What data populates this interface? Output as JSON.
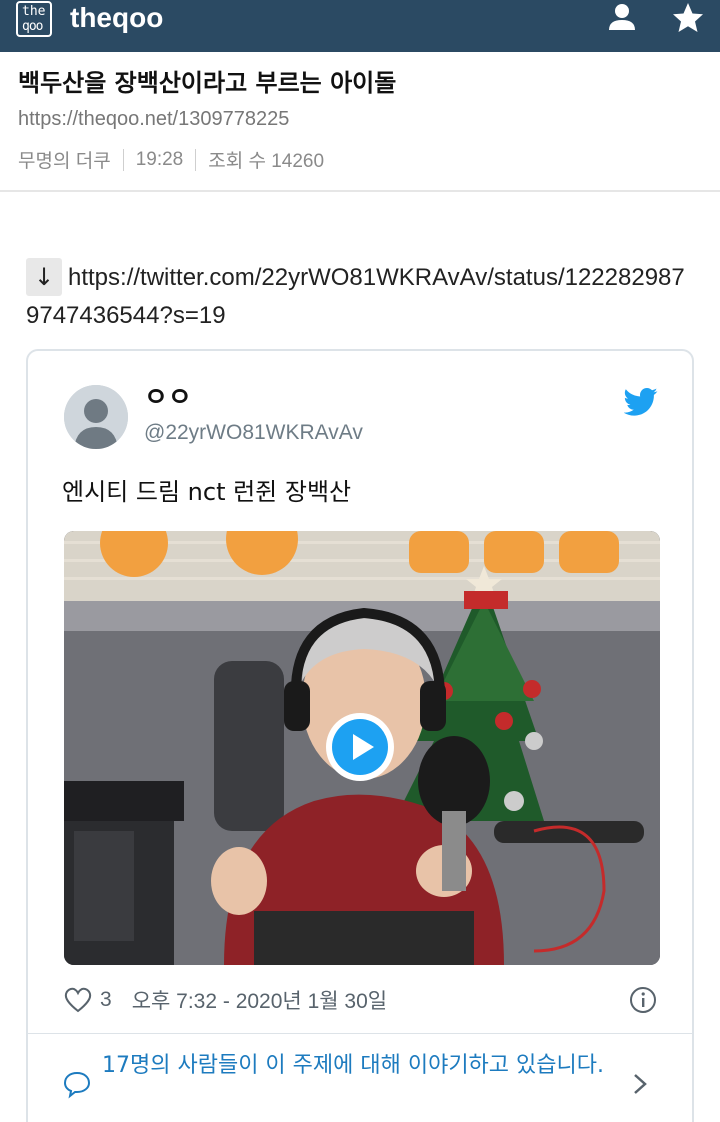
{
  "header": {
    "logo_line1": "the",
    "logo_line2": "qoo",
    "brand": "theqoo",
    "icons": [
      "user-icon",
      "star-icon"
    ],
    "bg_color": "#2b4a63"
  },
  "article": {
    "title": "백두산을 장백산이라고 부르는 아이돌",
    "url": "https://theqoo.net/1309778225",
    "author": "무명의 더쿠",
    "time": "19:28",
    "views_label": "조회 수 14260"
  },
  "link": {
    "arrow": "↓",
    "text": "https://twitter.com/22yrWO81WKRAvAv/status/1222829879747436544?s=19"
  },
  "tweet": {
    "display_name": "ㅇㅇ",
    "handle": "@22yrWO81WKRAvAv",
    "text": "엔시티 드림 nct 런쥔 장백산",
    "likes": "3",
    "timestamp": "오후 7:32 - 2020년 1월 30일",
    "discussion": "17명의 사람들이 이 주제에 대해 이야기하고 있습니다.",
    "accent_color": "#1da1f2",
    "link_color": "#1d7bbf"
  }
}
